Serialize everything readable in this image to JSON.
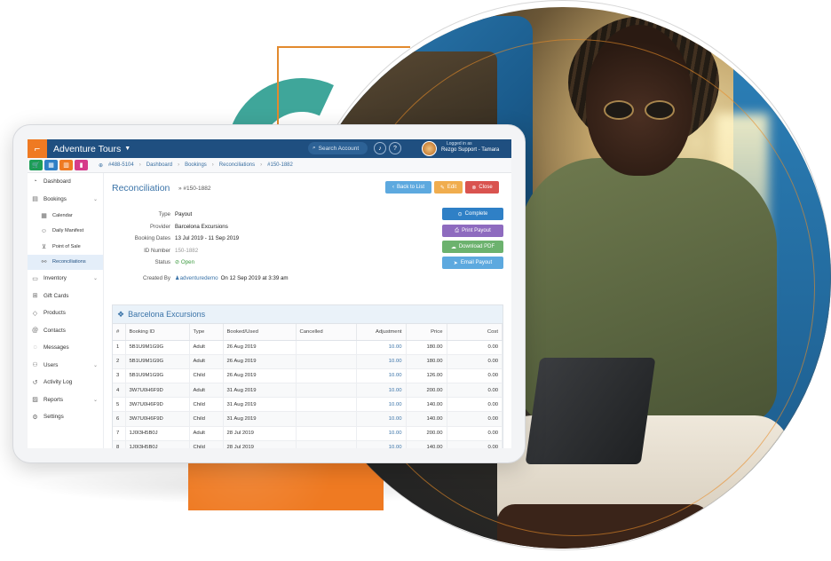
{
  "app": {
    "brand": "Adventure Tours",
    "logo_glyph": "⌐",
    "search_placeholder": "Search Account",
    "logged_in_as": "Logged in as",
    "account_name": "Rezgo Support - Tamara"
  },
  "breadcrumbs": [
    "#488-5104",
    "Dashboard",
    "Bookings",
    "Reconciliations",
    "#150-1882"
  ],
  "quick_buttons": [
    {
      "icon": "cart-icon",
      "glyph": "🛒",
      "color": "#1d9e57"
    },
    {
      "icon": "calendar-icon",
      "glyph": "▦",
      "color": "#2f80c6"
    },
    {
      "icon": "building-icon",
      "glyph": "▥",
      "color": "#ef7a22"
    },
    {
      "icon": "chart-icon",
      "glyph": "▮",
      "color": "#d63b8a"
    }
  ],
  "sidebar": {
    "items": [
      {
        "label": "Dashboard",
        "icon": "gauge-icon",
        "glyph": "◔"
      },
      {
        "label": "Bookings",
        "icon": "bookings-icon",
        "glyph": "▤",
        "chevron": "⌄"
      },
      {
        "label": "Calendar",
        "icon": "calendar-icon",
        "glyph": "▦",
        "sub": true
      },
      {
        "label": "Daily Manifest",
        "icon": "user-icon",
        "glyph": "☺",
        "sub": true
      },
      {
        "label": "Point of Sale",
        "icon": "cart-icon",
        "glyph": "⊻",
        "sub": true
      },
      {
        "label": "Reconciliations",
        "icon": "reconcile-icon",
        "glyph": "⚯",
        "sub": true,
        "active": true
      },
      {
        "label": "Inventory",
        "icon": "inventory-icon",
        "glyph": "▭",
        "chevron": "⌄"
      },
      {
        "label": "Gift Cards",
        "icon": "gift-icon",
        "glyph": "⊞"
      },
      {
        "label": "Products",
        "icon": "tag-icon",
        "glyph": "◇"
      },
      {
        "label": "Contacts",
        "icon": "at-icon",
        "glyph": "@"
      },
      {
        "label": "Messages",
        "icon": "chat-icon",
        "glyph": "◌"
      },
      {
        "label": "Users",
        "icon": "users-icon",
        "glyph": "⚇",
        "chevron": "⌄"
      },
      {
        "label": "Activity Log",
        "icon": "history-icon",
        "glyph": "↺"
      },
      {
        "label": "Reports",
        "icon": "reports-icon",
        "glyph": "▨",
        "chevron": "⌄"
      },
      {
        "label": "Settings",
        "icon": "gear-icon",
        "glyph": "⚙"
      }
    ]
  },
  "page": {
    "title": "Reconciliation",
    "id": "» #150-1882",
    "header_buttons": {
      "back": "Back to List",
      "edit": "Edit",
      "close": "Close"
    }
  },
  "details": {
    "type_label": "Type",
    "type": "Payout",
    "provider_label": "Provider",
    "provider": "Barcelona Excursions",
    "dates_label": "Booking Dates",
    "dates": "13 Jul 2019 - 11 Sep 2019",
    "idnum_label": "ID Number",
    "idnum": "150-1882",
    "status_label": "Status",
    "status": "Open",
    "created_label": "Created By",
    "created_user": "adventuredemo",
    "created_on": "On 12 Sep 2019 at 3:39 am"
  },
  "actions": {
    "complete": "Complete",
    "print": "Print Payout",
    "download": "Download PDF",
    "email": "Email Payout"
  },
  "panel": {
    "title": "Barcelona Excursions",
    "columns": [
      "#",
      "Booking ID",
      "Type",
      "Booked/Used",
      "Cancelled",
      "Adjustment",
      "Price",
      "Cost"
    ],
    "rows": [
      [
        "1",
        "5B1U9M1G9G",
        "Adult",
        "26 Aug 2019",
        "",
        "10.00",
        "180.00",
        "0.00"
      ],
      [
        "2",
        "5B1U9M1G9G",
        "Adult",
        "26 Aug 2019",
        "",
        "10.00",
        "180.00",
        "0.00"
      ],
      [
        "3",
        "5B1U9M1G9G",
        "Child",
        "26 Aug 2019",
        "",
        "10.00",
        "126.00",
        "0.00"
      ],
      [
        "4",
        "3W7U0H6F9D",
        "Adult",
        "31 Aug 2019",
        "",
        "10.00",
        "200.00",
        "0.00"
      ],
      [
        "5",
        "3W7U0H6F9D",
        "Child",
        "31 Aug 2019",
        "",
        "10.00",
        "140.00",
        "0.00"
      ],
      [
        "6",
        "3W7U0H6F9D",
        "Child",
        "31 Aug 2019",
        "",
        "10.00",
        "140.00",
        "0.00"
      ],
      [
        "7",
        "1J0I3H5B0J",
        "Adult",
        "28 Jul 2019",
        "",
        "10.00",
        "200.00",
        "0.00"
      ],
      [
        "8",
        "1J0I3H5B0J",
        "Child",
        "28 Jul 2019",
        "",
        "10.00",
        "140.00",
        "0.00"
      ]
    ]
  },
  "colors": {
    "navy": "#1f4f80",
    "orange": "#ef7a22",
    "link": "#3a73a8",
    "back_btn": "#5da9df",
    "edit_btn": "#f0ad4e",
    "close_btn": "#d9534f",
    "complete_btn": "#2f80c6",
    "print_btn": "#8e6bbf",
    "download_btn": "#6cb26e",
    "email_btn": "#5da9df"
  }
}
